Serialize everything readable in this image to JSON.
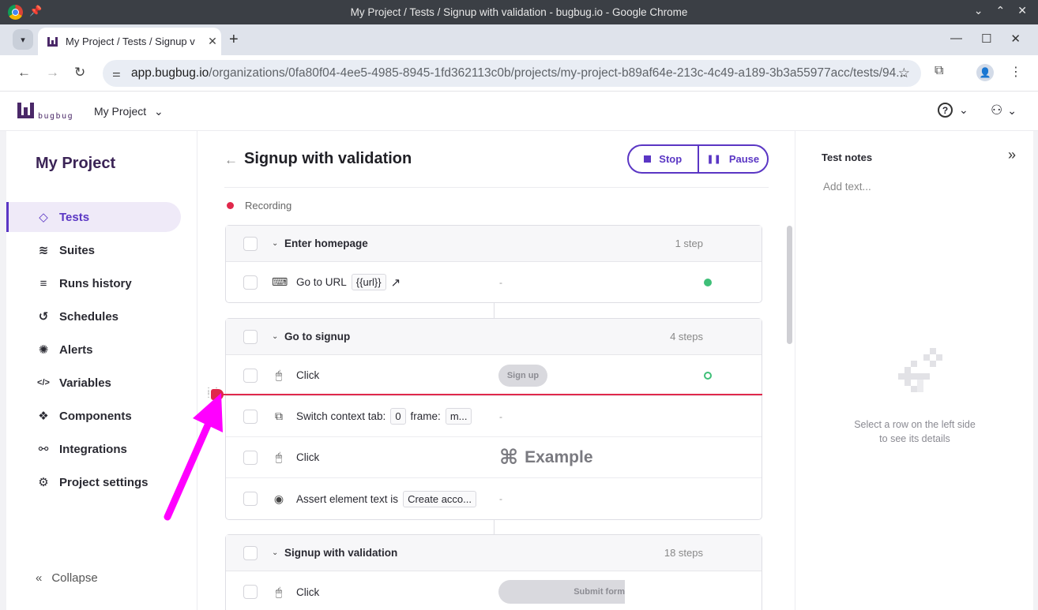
{
  "window": {
    "title": "My Project / Tests / Signup with validation - bugbug.io - Google Chrome",
    "tab_title": "My Project / Tests / Signup v"
  },
  "browser": {
    "url_host": "app.bugbug.io",
    "url_path": "/organizations/0fa80f04-4ee5-4985-8945-1fd362113c0b/projects/my-project-b89af64e-213c-4c49-a189-3b3a55977acc/tests/94..."
  },
  "header": {
    "logo_text": "bugbug",
    "project_selector": "My Project"
  },
  "sidebar": {
    "project_name": "My Project",
    "items": [
      {
        "label": "Tests",
        "icon": "diamond-icon",
        "glyph": "◇"
      },
      {
        "label": "Suites",
        "icon": "layers-icon",
        "glyph": "≋"
      },
      {
        "label": "Runs history",
        "icon": "list-check-icon",
        "glyph": "≡"
      },
      {
        "label": "Schedules",
        "icon": "history-icon",
        "glyph": "↺"
      },
      {
        "label": "Alerts",
        "icon": "siren-icon",
        "glyph": "✺"
      },
      {
        "label": "Variables",
        "icon": "code-icon",
        "glyph": "</>"
      },
      {
        "label": "Components",
        "icon": "components-icon",
        "glyph": "❖"
      },
      {
        "label": "Integrations",
        "icon": "integrations-icon",
        "glyph": "⚯"
      },
      {
        "label": "Project settings",
        "icon": "gear-icon",
        "glyph": "⚙"
      }
    ],
    "collapse_label": "Collapse"
  },
  "main": {
    "test_title": "Signup with validation",
    "stop_label": "Stop",
    "pause_label": "Pause",
    "status_label": "Recording",
    "groups": [
      {
        "name": "Enter homepage",
        "count": "1 step",
        "steps": [
          {
            "name": "Go to URL",
            "chip": "{{url}}",
            "dash": "-"
          }
        ]
      },
      {
        "name": "Go to signup",
        "count": "4 steps",
        "steps": [
          {
            "name": "Click",
            "pill": "Sign up"
          },
          {
            "name": "Switch context tab:",
            "chip": "0",
            "name2": "frame:",
            "chip2": "m...",
            "dash": "-"
          },
          {
            "name": "Click",
            "example": "Example"
          },
          {
            "name": "Assert element text is",
            "chip": "Create acco...",
            "dash": "-"
          }
        ]
      },
      {
        "name": "Signup with validation",
        "count": "18 steps",
        "steps": [
          {
            "name": "Click",
            "pill": "Submit form"
          }
        ]
      }
    ]
  },
  "right_panel": {
    "title": "Test notes",
    "placeholder": "Add text...",
    "empty_line1": "Select a row on the left side",
    "empty_line2": "to see its details"
  },
  "colors": {
    "accent": "#5a36c4",
    "recording": "#e0284b",
    "success": "#3fbf78",
    "annotation_arrow": "#ff00ff"
  }
}
